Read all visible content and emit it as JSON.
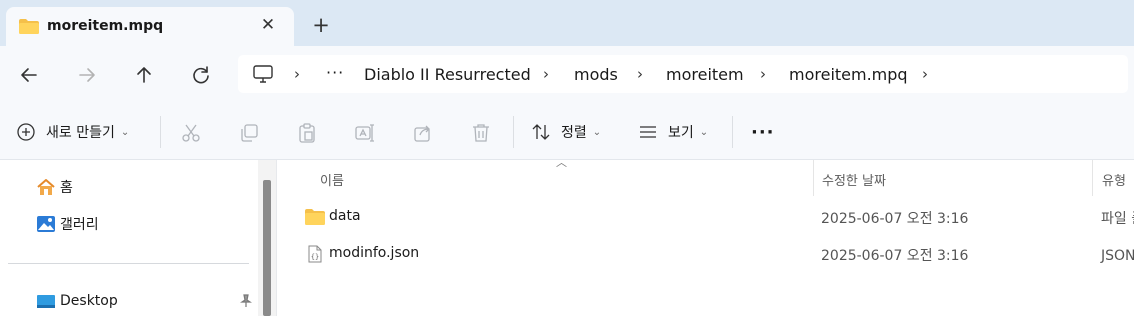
{
  "tab": {
    "title": "moreitem.mpq",
    "close_glyph": "✕",
    "new_tab_glyph": "+"
  },
  "nav": {
    "back_icon": "arrow-left-icon",
    "forward_icon": "arrow-right-icon",
    "up_icon": "arrow-up-icon",
    "refresh_icon": "refresh-icon"
  },
  "address": {
    "overflow": "···",
    "crumbs": [
      "Diablo II Resurrected",
      "mods",
      "moreitem",
      "moreitem.mpq"
    ],
    "separator": "›"
  },
  "commands": {
    "new_label": "새로 만들기",
    "sort_label": "정렬",
    "view_label": "보기",
    "more_glyph": "···"
  },
  "sidebar": {
    "items": [
      {
        "label": "홈",
        "icon": "home-icon"
      },
      {
        "label": "갤러리",
        "icon": "gallery-icon"
      },
      {
        "label": "Desktop",
        "icon": "desktop-icon"
      }
    ],
    "pin_glyph": "📌"
  },
  "columns": {
    "name": "이름",
    "date": "수정한 날짜",
    "type": "유형"
  },
  "files": [
    {
      "name": "data",
      "date": "2025-06-07 오전 3:16",
      "type": "파일 폴더",
      "icon": "folder-icon"
    },
    {
      "name": "modinfo.json",
      "date": "2025-06-07 오전 3:16",
      "type": "JSON 파일",
      "icon": "json-file-icon"
    }
  ],
  "colors": {
    "tabstrip_bg": "#dce8f4",
    "chrome_bg": "#f7f9fc",
    "folder_yellow": "#f5c04a"
  }
}
